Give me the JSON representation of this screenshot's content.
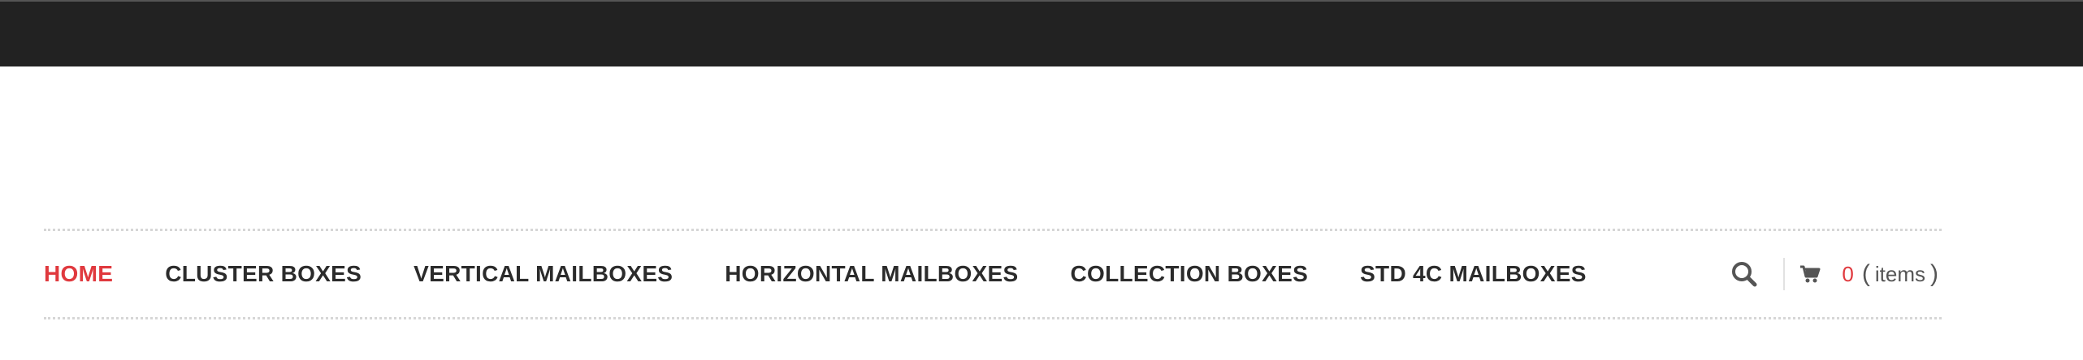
{
  "nav": {
    "items": [
      {
        "label": "HOME",
        "active": true
      },
      {
        "label": "CLUSTER BOXES",
        "active": false
      },
      {
        "label": "VERTICAL MAILBOXES",
        "active": false
      },
      {
        "label": "HORIZONTAL MAILBOXES",
        "active": false
      },
      {
        "label": "COLLECTION BOXES",
        "active": false
      },
      {
        "label": "STD 4C MAILBOXES",
        "active": false
      }
    ]
  },
  "tools": {
    "search_icon": "search-icon",
    "cart_icon": "cart-icon",
    "cart_count": "0",
    "cart_open_paren": "(",
    "cart_label": "items",
    "cart_close_paren": ")"
  },
  "colors": {
    "topbar": "#222222",
    "accent": "#e0393e",
    "nav_text": "#2b2b2b"
  }
}
